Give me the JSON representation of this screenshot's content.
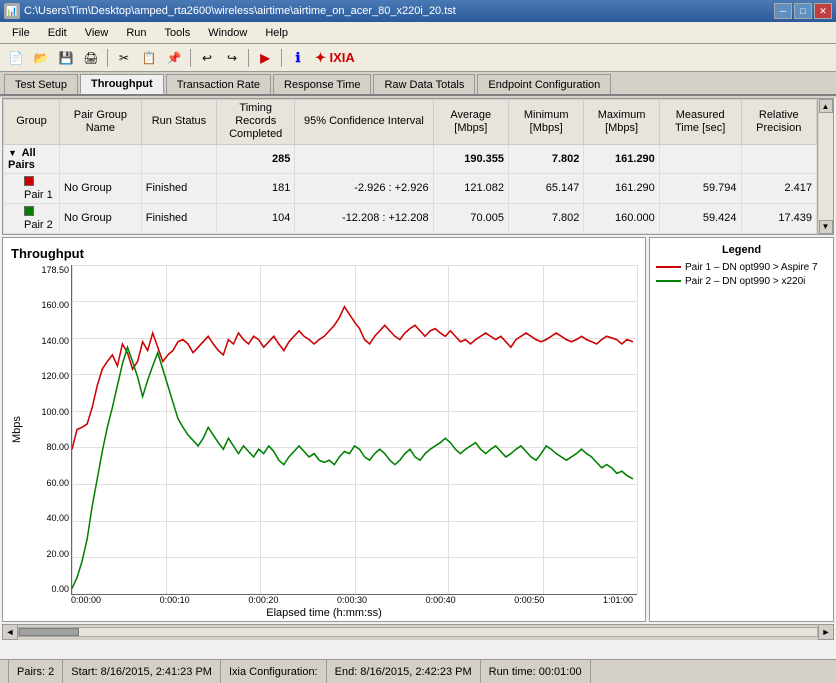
{
  "titlebar": {
    "title": "C:\\Users\\Tim\\Desktop\\amped_rta2600\\wireless\\airtime\\airtime_on_acer_80_x220i_20.tst",
    "min": "─",
    "max": "□",
    "close": "✕"
  },
  "menubar": {
    "items": [
      "File",
      "Edit",
      "View",
      "Run",
      "Tools",
      "Window",
      "Help"
    ]
  },
  "tabs": {
    "items": [
      "Test Setup",
      "Throughput",
      "Transaction Rate",
      "Response Time",
      "Raw Data Totals",
      "Endpoint Configuration"
    ],
    "active": "Throughput"
  },
  "table": {
    "headers": {
      "group": "Group",
      "pair_group_name": "Pair Group Name",
      "run_status": "Run Status",
      "timing_records_completed": "Timing Records Completed",
      "confidence_interval": "95% Confidence Interval",
      "average_mbps": "Average [Mbps]",
      "minimum_mbps": "Minimum [Mbps]",
      "maximum_mbps": "Maximum [Mbps]",
      "measured_time_sec": "Measured Time [sec]",
      "relative_precision": "Relative Precision"
    },
    "all_pairs": {
      "label": "All Pairs",
      "records": "285",
      "confidence": "",
      "average": "190.355",
      "minimum": "7.802",
      "maximum": "161.290",
      "measured_time": "",
      "relative_precision": ""
    },
    "rows": [
      {
        "id": "1",
        "label": "Pair 1",
        "group_name": "No Group",
        "run_status": "Finished",
        "records": "181",
        "confidence": "-2.926 : +2.926",
        "average": "121.082",
        "minimum": "65.147",
        "maximum": "161.290",
        "measured_time": "59.794",
        "relative_precision": "2.417",
        "color": "#cc0000"
      },
      {
        "id": "2",
        "label": "Pair 2",
        "group_name": "No Group",
        "run_status": "Finished",
        "records": "104",
        "confidence": "-12.208 : +12.208",
        "average": "70.005",
        "minimum": "7.802",
        "maximum": "160.000",
        "measured_time": "59.424",
        "relative_precision": "17.439",
        "color": "#008000"
      }
    ]
  },
  "chart": {
    "title": "Throughput",
    "y_label": "Mbps",
    "x_label": "Elapsed time (h:mm:ss)",
    "y_ticks": [
      "178.50",
      "160.00",
      "140.00",
      "120.00",
      "100.00",
      "80.00",
      "60.00",
      "40.00",
      "20.00",
      "0.00"
    ],
    "x_ticks": [
      "0:00:00",
      "0:00:10",
      "0:00:20",
      "0:00:30",
      "0:00:40",
      "0:00:50",
      "1:01:00"
    ],
    "legend": {
      "title": "Legend",
      "items": [
        {
          "label": "Pair 1 – DN opt990 > Aspire 7",
          "color": "#cc0000"
        },
        {
          "label": "Pair 2 – DN opt990 > x220i",
          "color": "#008000"
        }
      ]
    }
  },
  "statusbar": {
    "pairs": "Pairs: 2",
    "start": "Start: 8/16/2015, 2:41:23 PM",
    "ixia_config": "Ixia Configuration:",
    "end": "End: 8/16/2015, 2:42:23 PM",
    "run_time": "Run time: 00:01:00"
  }
}
